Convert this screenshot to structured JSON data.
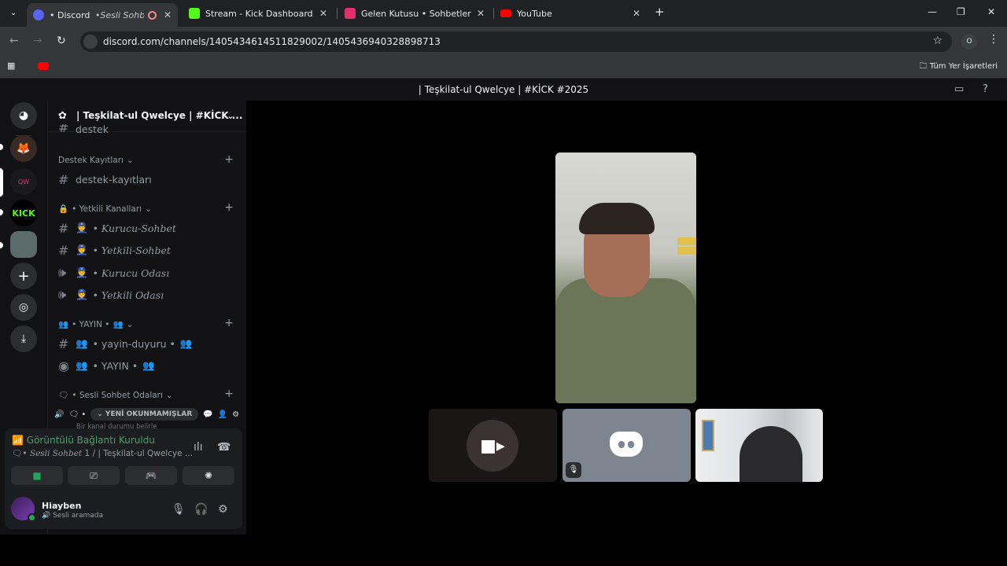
{
  "browser": {
    "tabs": [
      {
        "title": "• Discord | ",
        "subtitle": "•Sesli Sohbet",
        "active": true,
        "favicon_color": "#5865f2"
      },
      {
        "title": "Stream - Kick Dashboard",
        "favicon_color": "#53fc18"
      },
      {
        "title": "Gelen Kutusu • Sohbetler",
        "favicon_color": "#e1306c"
      },
      {
        "title": "YouTube",
        "favicon_color": "#ff0000"
      }
    ],
    "url": "discord.com/channels/1405434614511829002/1405436940328898713",
    "profile_initial": "O",
    "bookmarks_all": "Tüm Yer İşaretleri"
  },
  "discord": {
    "window_title": "| Teşkilat-ul Qwelcye | #KİCK #2025",
    "server_name": "| Teşkilat-ul Qwelcye | #KİCK ...",
    "guild_kick_label": "KICK",
    "channels": {
      "top_partial": "destek",
      "cat1": "Destek Kayıtları",
      "ch_destek": "destek-kayıtları",
      "cat2": "• Yetkili Kanalları",
      "ch_kurucu_sohbet": "• Kurucu-Sohbet",
      "ch_yetkili_sohbet": "• Yetkili-Sohbet",
      "ch_kurucu_odasi": "• Kurucu Odası",
      "ch_yetkili_odasi": "• Yetkili Odası",
      "cat3": "• YAYIN •",
      "ch_yayin_duyuru": "• yayin-duyuru •",
      "ch_yayin": "• YAYIN •",
      "cat4": "• Sesli Sohbet Odaları",
      "unread_badge": "YENİ OKUNMAMIŞLAR",
      "partial_below": "Bir kanal durumu belirle"
    },
    "voice": {
      "status": "Görüntülü Bağlantı Kuruldu",
      "channel_prefix": "• ",
      "channel_italic": "Sesli Sohbet",
      "channel_rest": " 1 / | Teşkilat-ul Qwelcye ..."
    },
    "user": {
      "name": "Hiayben",
      "status": "Sesli aramada"
    },
    "accent_green": "#23a55a",
    "blurple": "#5865f2"
  }
}
